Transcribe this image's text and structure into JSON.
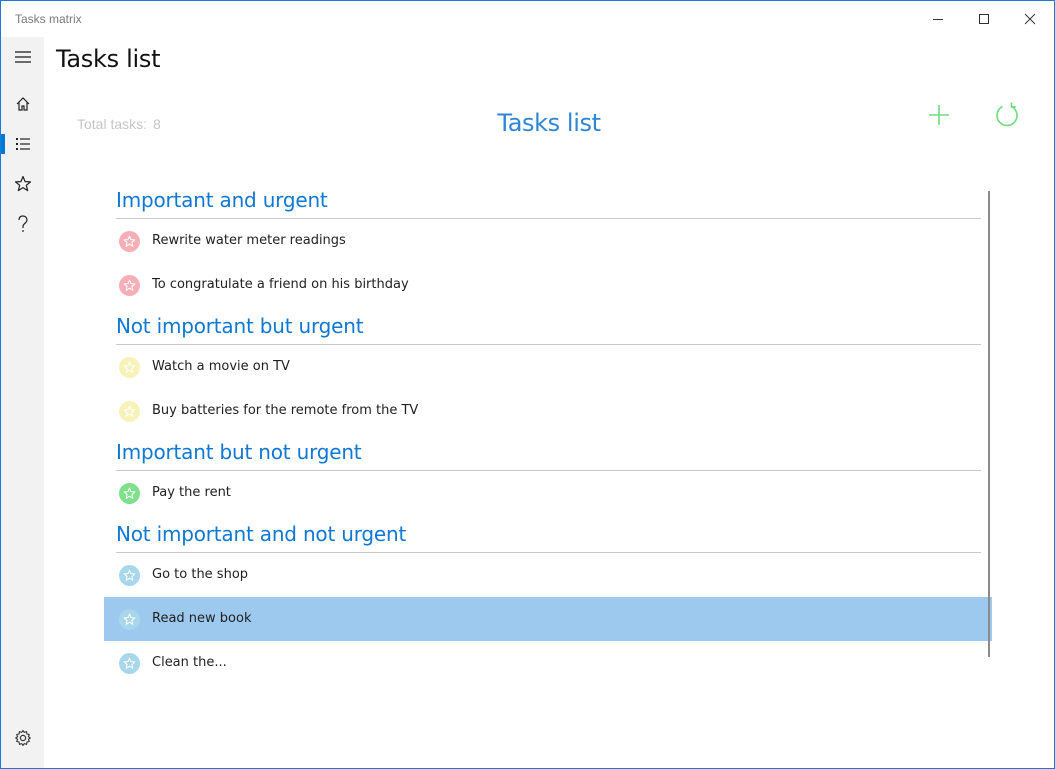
{
  "window": {
    "app_title": "Tasks matrix"
  },
  "nav": {
    "items": [
      {
        "name": "menu",
        "icon": "hamburger-icon"
      },
      {
        "name": "home",
        "icon": "home-icon"
      },
      {
        "name": "tasks-list",
        "icon": "list-icon",
        "selected": true
      },
      {
        "name": "favorites",
        "icon": "star-icon"
      },
      {
        "name": "help",
        "icon": "question-icon"
      },
      {
        "name": "settings",
        "icon": "gear-icon"
      }
    ],
    "accent": "#0078d7"
  },
  "page": {
    "header": "Tasks list",
    "total_label": "Total tasks:",
    "total_count": "8",
    "center_title": "Tasks list"
  },
  "colors": {
    "title_blue": "#2f86d6",
    "group_blue": "#0f78d4",
    "action_green": "#6fdc7e",
    "selected_row": "#9ec9ee",
    "important_urgent": "#f7aeb7",
    "not_important_urgent": "#f6f2b8",
    "important_not_urgent": "#7ee08a",
    "not_important_not_urgent": "#a8d6ea"
  },
  "groups": [
    {
      "title": "Important and urgent",
      "color": "#f7aeb7",
      "tasks": [
        {
          "label": "Rewrite water meter readings"
        },
        {
          "label": "To congratulate a friend on his birthday"
        }
      ]
    },
    {
      "title": "Not important but urgent",
      "color": "#f6f2b8",
      "tasks": [
        {
          "label": "Watch a movie on TV"
        },
        {
          "label": "Buy batteries for the remote from the TV"
        }
      ]
    },
    {
      "title": "Important but not urgent",
      "color": "#7ee08a",
      "tasks": [
        {
          "label": "Pay the rent"
        }
      ]
    },
    {
      "title": "Not important and not urgent",
      "color": "#a8d6ea",
      "tasks": [
        {
          "label": "Go to the shop"
        },
        {
          "label": "Read new book",
          "selected": true
        },
        {
          "label": "Clean the..."
        }
      ]
    }
  ]
}
